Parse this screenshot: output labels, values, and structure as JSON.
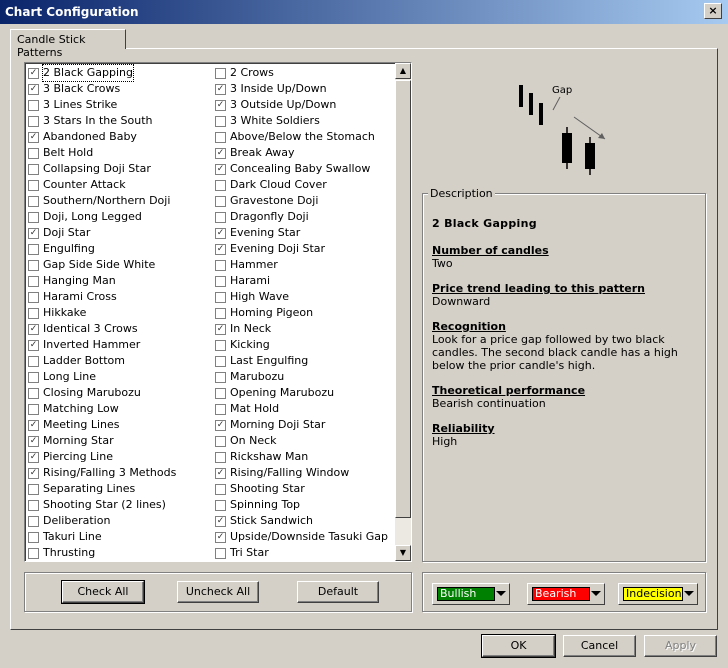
{
  "window": {
    "title": "Chart Configuration",
    "close_label": "×"
  },
  "tabs": [
    {
      "label": "Candle Stick Patterns"
    }
  ],
  "patterns_left": [
    {
      "label": "2 Black Gapping",
      "checked": true
    },
    {
      "label": "3 Black Crows",
      "checked": true
    },
    {
      "label": "3 Lines Strike",
      "checked": false
    },
    {
      "label": "3 Stars In the South",
      "checked": false
    },
    {
      "label": "Abandoned Baby",
      "checked": true
    },
    {
      "label": "Belt Hold",
      "checked": false
    },
    {
      "label": "Collapsing Doji Star",
      "checked": false
    },
    {
      "label": "Counter Attack",
      "checked": false
    },
    {
      "label": "Southern/Northern Doji",
      "checked": false
    },
    {
      "label": "Doji, Long Legged",
      "checked": false
    },
    {
      "label": "Doji Star",
      "checked": true
    },
    {
      "label": "Engulfing",
      "checked": false
    },
    {
      "label": "Gap Side Side White",
      "checked": false
    },
    {
      "label": "Hanging Man",
      "checked": false
    },
    {
      "label": "Harami Cross",
      "checked": false
    },
    {
      "label": "Hikkake",
      "checked": false
    },
    {
      "label": "Identical 3 Crows",
      "checked": true
    },
    {
      "label": "Inverted Hammer",
      "checked": true
    },
    {
      "label": "Ladder Bottom",
      "checked": false
    },
    {
      "label": "Long Line",
      "checked": false
    },
    {
      "label": "Closing Marubozu",
      "checked": false
    },
    {
      "label": "Matching Low",
      "checked": false
    },
    {
      "label": "Meeting Lines",
      "checked": true
    },
    {
      "label": "Morning Star",
      "checked": true
    },
    {
      "label": "Piercing Line",
      "checked": true
    },
    {
      "label": "Rising/Falling 3 Methods",
      "checked": true
    },
    {
      "label": "Separating Lines",
      "checked": false
    },
    {
      "label": "Shooting Star (2 lines)",
      "checked": false
    },
    {
      "label": "Deliberation",
      "checked": false
    },
    {
      "label": "Takuri Line",
      "checked": false
    },
    {
      "label": "Thrusting",
      "checked": false
    }
  ],
  "patterns_right": [
    {
      "label": "2 Crows",
      "checked": false
    },
    {
      "label": "3 Inside Up/Down",
      "checked": true
    },
    {
      "label": "3 Outside Up/Down",
      "checked": true
    },
    {
      "label": "3 White Soldiers",
      "checked": false
    },
    {
      "label": "Above/Below the Stomach",
      "checked": false
    },
    {
      "label": "Break Away",
      "checked": true
    },
    {
      "label": "Concealing Baby Swallow",
      "checked": true
    },
    {
      "label": "Dark Cloud Cover",
      "checked": false
    },
    {
      "label": "Gravestone Doji",
      "checked": false
    },
    {
      "label": "Dragonfly Doji",
      "checked": false
    },
    {
      "label": "Evening Star",
      "checked": true
    },
    {
      "label": "Evening Doji Star",
      "checked": true
    },
    {
      "label": "Hammer",
      "checked": false
    },
    {
      "label": "Harami",
      "checked": false
    },
    {
      "label": "High Wave",
      "checked": false
    },
    {
      "label": "Homing Pigeon",
      "checked": false
    },
    {
      "label": "In Neck",
      "checked": true
    },
    {
      "label": "Kicking",
      "checked": false
    },
    {
      "label": "Last Engulfing",
      "checked": false
    },
    {
      "label": "Marubozu",
      "checked": false
    },
    {
      "label": "Opening Marubozu",
      "checked": false
    },
    {
      "label": "Mat Hold",
      "checked": false
    },
    {
      "label": "Morning Doji Star",
      "checked": true
    },
    {
      "label": "On Neck",
      "checked": false
    },
    {
      "label": "Rickshaw Man",
      "checked": false
    },
    {
      "label": "Rising/Falling Window",
      "checked": true
    },
    {
      "label": "Shooting Star",
      "checked": false
    },
    {
      "label": "Spinning Top",
      "checked": false
    },
    {
      "label": "Stick Sandwich",
      "checked": true
    },
    {
      "label": "Upside/Downside Tasuki Gap",
      "checked": true
    },
    {
      "label": "Tri Star",
      "checked": false
    }
  ],
  "list_buttons": {
    "check_all": "Check All",
    "uncheck_all": "Uncheck All",
    "default": "Default"
  },
  "preview": {
    "gap_label": "Gap"
  },
  "description": {
    "legend": "Description",
    "title": "2 Black Gapping",
    "sections": [
      {
        "heading": "Number of candles",
        "body": "Two"
      },
      {
        "heading": "Price trend leading to this pattern",
        "body": "Downward"
      },
      {
        "heading": "Recognition",
        "body": "Look for a price gap followed by two black candles. The second black candle has a high below the prior candle's high."
      },
      {
        "heading": "Theoretical performance",
        "body": "Bearish continuation"
      },
      {
        "heading": "Reliability",
        "body": "High"
      }
    ]
  },
  "colors": [
    {
      "label": "Bullish",
      "color": "#008000",
      "text_color": "#ffffff"
    },
    {
      "label": "Bearish",
      "color": "#ff0000",
      "text_color": "#ffffff"
    },
    {
      "label": "Indecision",
      "color": "#ffff00",
      "text_color": "#000000"
    }
  ],
  "dialog_buttons": {
    "ok": "OK",
    "cancel": "Cancel",
    "apply": "Apply"
  }
}
